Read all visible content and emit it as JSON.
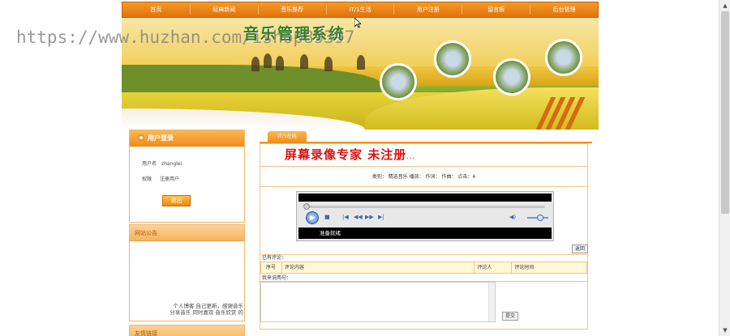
{
  "nav": {
    "items": [
      "首页",
      "经典新闻",
      "音乐推荐",
      "IT/1生活",
      "用户注册",
      "留言板",
      "后台管理"
    ]
  },
  "banner": {
    "title": "音乐管理系统"
  },
  "watermark": "https://www.huzhan.com/ishop89397",
  "login_box": {
    "title": "用户登录",
    "username_label": "用户名",
    "username_value": "zhanglei",
    "role_label": "权限",
    "role_value": "注册用户",
    "logout_button": "退出"
  },
  "notice_box": {
    "title": "网站公告",
    "text_line1": "个人博客 自己更新，感谢音乐",
    "text_line2": "分享音乐   同时喜欢   音乐欣赏   的"
  },
  "links_box": {
    "title": "友情链接"
  },
  "main": {
    "tab_label": "IT/1在线",
    "recorder_text": "屏幕录像专家  未注册",
    "recorder_suffix": "...",
    "info_line": "类别： 精选音乐  播放：  作词：  作曲：  点击：4",
    "player_status": "准备就绪",
    "back_button": "返回",
    "comments_label": "已有评论：",
    "comment_headers": [
      "序号",
      "评论内容",
      "评论人",
      "评论时间"
    ],
    "publish_label": "我来说两句：",
    "submit_button": "提交"
  },
  "colors": {
    "accent": "#f18f19",
    "nav_border": "#c85f00",
    "red_title": "#e01010"
  }
}
